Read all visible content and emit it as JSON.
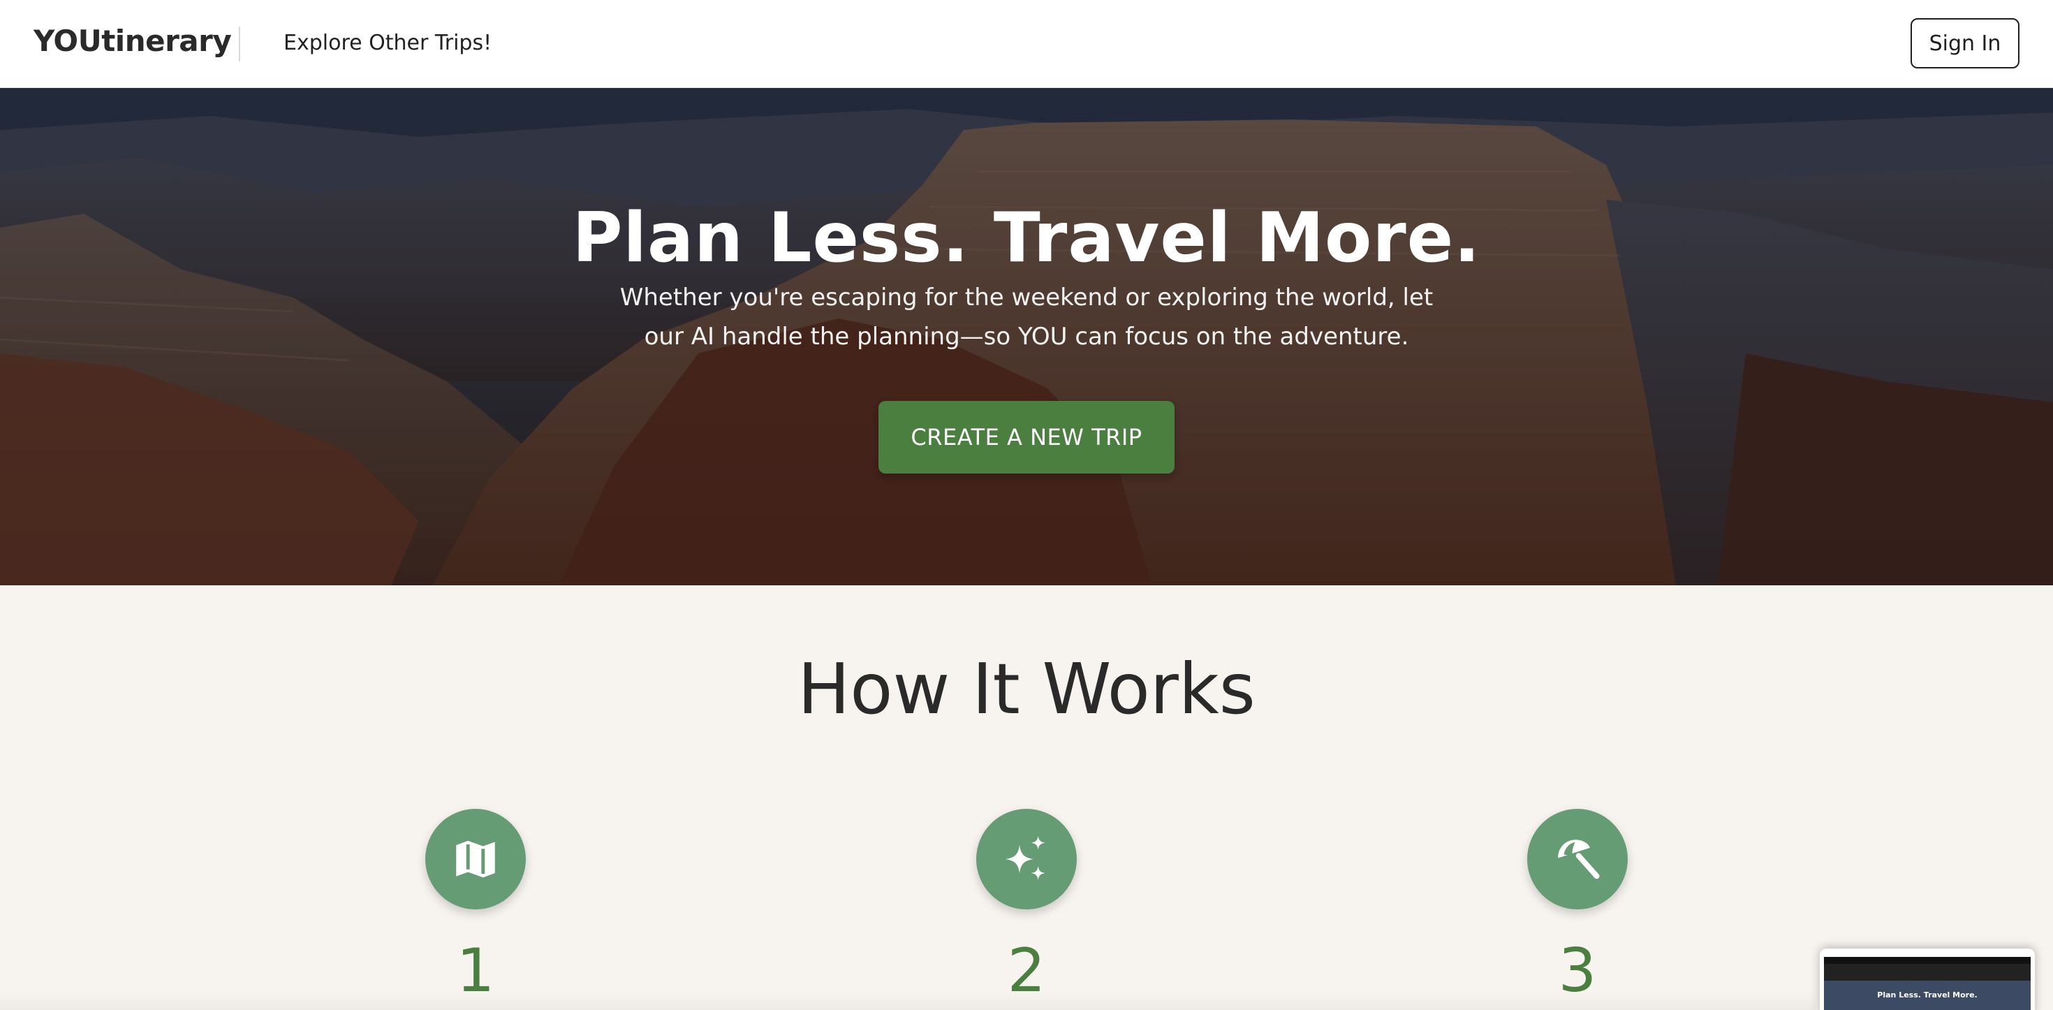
{
  "header": {
    "brand": "YOUtinerary",
    "nav_link": "Explore Other Trips!",
    "signin_label": "Sign In"
  },
  "hero": {
    "title": "Plan Less. Travel More.",
    "subtitle": "Whether you're escaping for the weekend or exploring the world, let our AI handle the planning—so YOU can focus on the adventure.",
    "cta_label": "CREATE A NEW TRIP",
    "background": "grand-canyon-photo"
  },
  "how_it_works": {
    "title": "How It Works",
    "steps": [
      {
        "number": "1",
        "icon": "map-icon"
      },
      {
        "number": "2",
        "icon": "sparkles-icon"
      },
      {
        "number": "3",
        "icon": "beach-umbrella-icon"
      }
    ]
  },
  "preview": {
    "text": "Plan Less. Travel More."
  },
  "colors": {
    "accent_green": "#4a7f40",
    "icon_circle": "#669c74",
    "page_bg": "#f7f3ef"
  }
}
